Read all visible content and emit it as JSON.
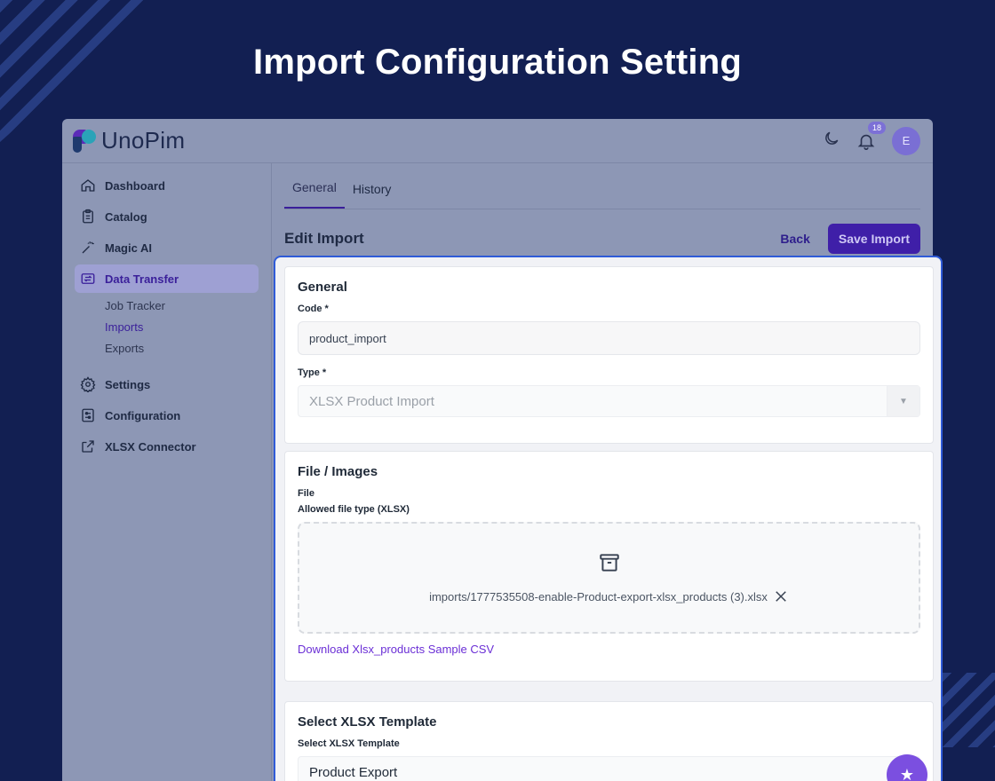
{
  "hero": {
    "title": "Import Configuration Setting"
  },
  "app": {
    "logo_text": "UnoPim",
    "notifications_count": "18",
    "avatar_initial": "E"
  },
  "sidebar": {
    "items": [
      {
        "label": "Dashboard",
        "icon": "home-icon"
      },
      {
        "label": "Catalog",
        "icon": "clipboard-icon"
      },
      {
        "label": "Magic AI",
        "icon": "magic-wand-icon"
      },
      {
        "label": "Data Transfer",
        "icon": "transfer-icon",
        "active": true
      },
      {
        "label": "Settings",
        "icon": "gear-icon"
      },
      {
        "label": "Configuration",
        "icon": "sliders-icon"
      },
      {
        "label": "XLSX Connector",
        "icon": "share-icon"
      }
    ],
    "sub_items": [
      "Job Tracker",
      "Imports",
      "Exports"
    ]
  },
  "tabs": [
    "General",
    "History"
  ],
  "page": {
    "title": "Edit Import",
    "back_label": "Back",
    "save_label": "Save Import"
  },
  "general": {
    "title": "General",
    "code_label": "Code *",
    "code_value": "product_import",
    "type_label": "Type *",
    "type_value": "XLSX Product Import"
  },
  "files": {
    "title": "File / Images",
    "file_label": "File",
    "allowed_label": "Allowed file type (XLSX)",
    "file_name": "imports/1777535508-enable-Product-export-xlsx_products (3).xlsx",
    "download_link": "Download Xlsx_products Sample CSV"
  },
  "template": {
    "title": "Select XLSX Template",
    "label": "Select XLSX Template",
    "value": "Product Export"
  },
  "colors": {
    "background": "#121f52",
    "accent": "#3f1fa8",
    "focus_border": "#2f5bd8",
    "link": "#6b2fd6"
  }
}
